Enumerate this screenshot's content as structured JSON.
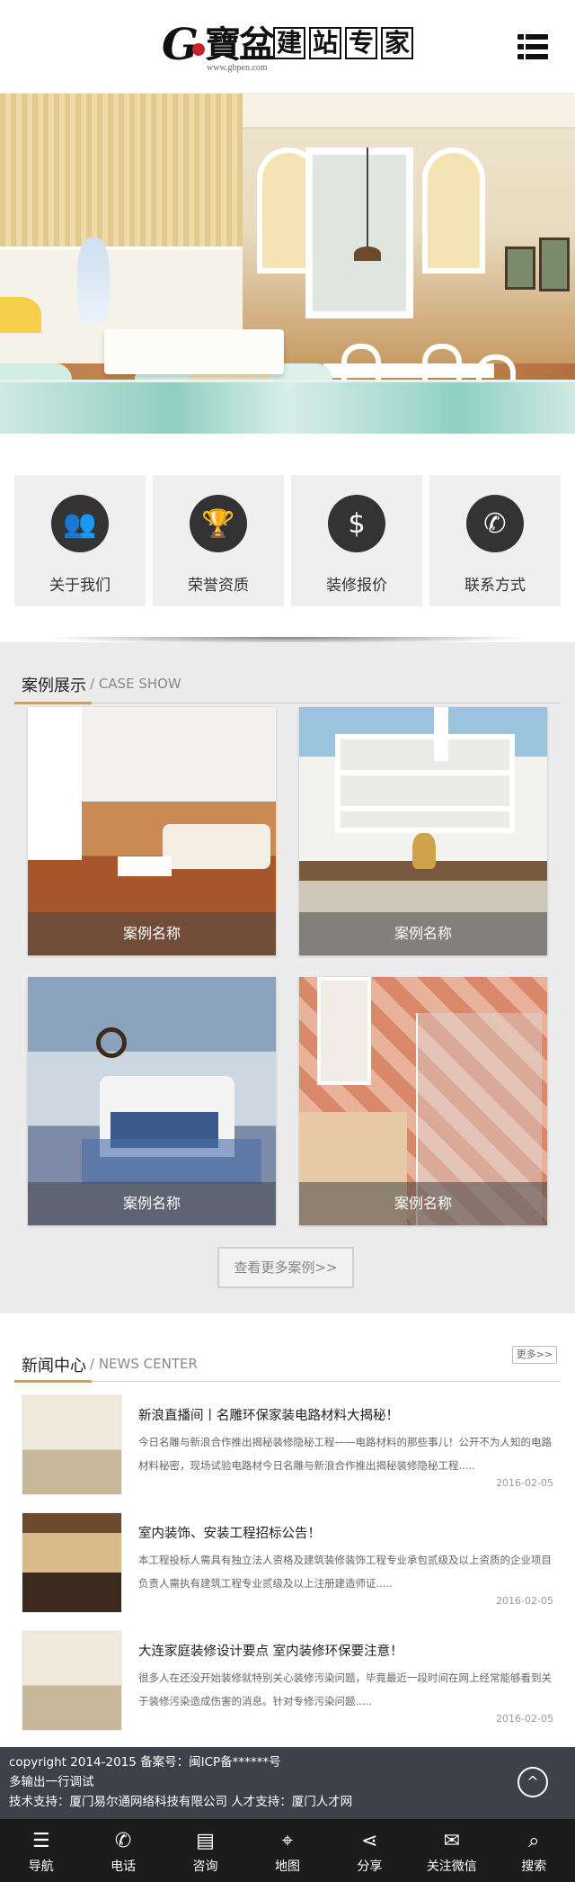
{
  "header": {
    "logo_letter": "G",
    "logo_calligraphy": "寶盆",
    "logo_boxes": [
      "建",
      "站",
      "专",
      "家"
    ],
    "logo_url": "www.gbpen.com",
    "menu_icon": "menu-icon"
  },
  "quick_nav": [
    {
      "label": "关于我们",
      "icon": "people-icon",
      "glyph": "👥"
    },
    {
      "label": "荣誉资质",
      "icon": "trophy-icon",
      "glyph": "🏆"
    },
    {
      "label": "装修报价",
      "icon": "money-icon",
      "glyph": "$"
    },
    {
      "label": "联系方式",
      "icon": "phone-icon",
      "glyph": "✆"
    }
  ],
  "case_section": {
    "title_zh": "案例展示",
    "title_en": "/ CASE SHOW",
    "cases": [
      {
        "caption": "案例名称"
      },
      {
        "caption": "案例名称"
      },
      {
        "caption": "案例名称"
      },
      {
        "caption": "案例名称"
      }
    ],
    "more_label": "查看更多案例>>"
  },
  "news_section": {
    "title_zh": "新闻中心",
    "title_en": "/ NEWS CENTER",
    "more_label": "更多>>",
    "items": [
      {
        "title": "新浪直播间丨名雕环保家装电路材料大揭秘！",
        "desc": "今日名雕与新浪合作推出揭秘装修隐秘工程——电路材料的那些事儿！公开不为人知的电路材料秘密，现场试验电路材今日名雕与新浪合作推出揭秘装修隐秘工程.....",
        "date": "2016-02-05"
      },
      {
        "title": "室内装饰、安装工程招标公告！",
        "desc": "本工程投标人需具有独立法人资格及建筑装修装饰工程专业承包贰级及以上资质的企业项目负责人需执有建筑工程专业贰级及以上注册建造师证.....",
        "date": "2016-02-05"
      },
      {
        "title": "大连家庭装修设计要点 室内装修环保要注意！",
        "desc": "很多人在还没开始装修就特别关心装修污染问题，毕竟最近一段时间在网上经常能够看到关于装修污染造成伤害的消息。针对专修污染问题.....",
        "date": "2016-02-05"
      }
    ]
  },
  "footer": {
    "line1": "copyright 2014-2015 备案号：闽ICP备******号",
    "line2": "多输出一行调试",
    "line3": "技术支持：厦门易尔通网络科技有限公司 人才支持：厦门人才网",
    "top_icon": "back-to-top-icon"
  },
  "bottom_nav": [
    {
      "label": "导航",
      "icon": "nav-icon",
      "glyph": "☰"
    },
    {
      "label": "电话",
      "icon": "phone-icon",
      "glyph": "✆"
    },
    {
      "label": "咨询",
      "icon": "chat-icon",
      "glyph": "▤"
    },
    {
      "label": "地图",
      "icon": "map-icon",
      "glyph": "⌖"
    },
    {
      "label": "分享",
      "icon": "share-icon",
      "glyph": "⋖"
    },
    {
      "label": "关注微信",
      "icon": "wechat-icon",
      "glyph": "✉"
    },
    {
      "label": "搜索",
      "icon": "search-icon",
      "glyph": "⌕"
    }
  ]
}
